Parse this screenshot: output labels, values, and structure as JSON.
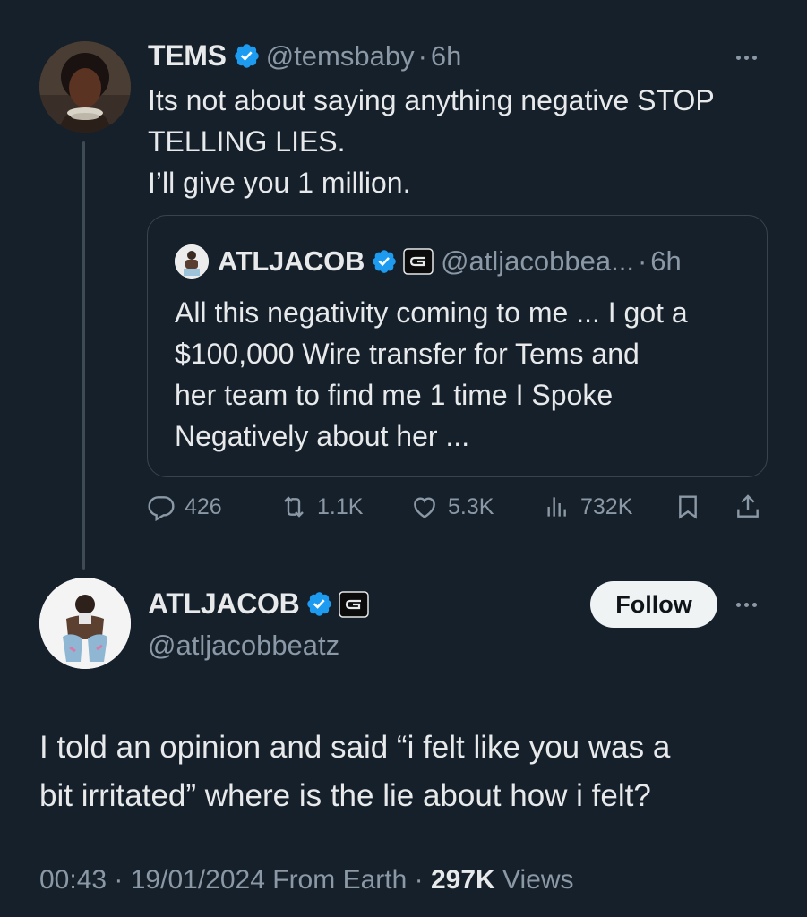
{
  "parent_tweet": {
    "name": "TEMS",
    "handle": "@temsbaby",
    "separator": "·",
    "time": "6h",
    "text_lines": [
      "Its not about saying anything negative STOP",
      "TELLING LIES.",
      "I’ll give you 1 million."
    ]
  },
  "quoted_tweet": {
    "name": "ATLJACOB",
    "handle": "@atljacobbea...",
    "separator": "·",
    "time": "6h",
    "text_lines": [
      "All this negativity coming to me ... I got a",
      "$100,000 Wire transfer for Tems and",
      "her team to find me 1 time I Spoke",
      "Negatively about her ..."
    ]
  },
  "actions": {
    "replies": "426",
    "retweets": "1.1K",
    "likes": "5.3K",
    "views": "732K"
  },
  "reply_tweet": {
    "name": "ATLJACOB",
    "handle": "@atljacobbeatz",
    "follow_label": "Follow",
    "text_lines": [
      "I told an opinion and said “i felt like you was a",
      "bit irritated” where is the lie about how i felt?"
    ],
    "footer": {
      "time": "00:43",
      "dot1": " · ",
      "date": "19/01/2024",
      "source": " From Earth",
      "dot2": " · ",
      "views_count": "297K",
      "views_label": " Views"
    }
  },
  "colors": {
    "background": "#15202b",
    "text": "#e7e9ea",
    "muted": "#8b98a5",
    "verified": "#1d9bf0",
    "border": "#38444d"
  },
  "icons": [
    "verified-badge-icon",
    "g-badge-icon",
    "more-icon",
    "reply-icon",
    "retweet-icon",
    "like-icon",
    "views-icon",
    "bookmark-icon",
    "share-icon"
  ]
}
